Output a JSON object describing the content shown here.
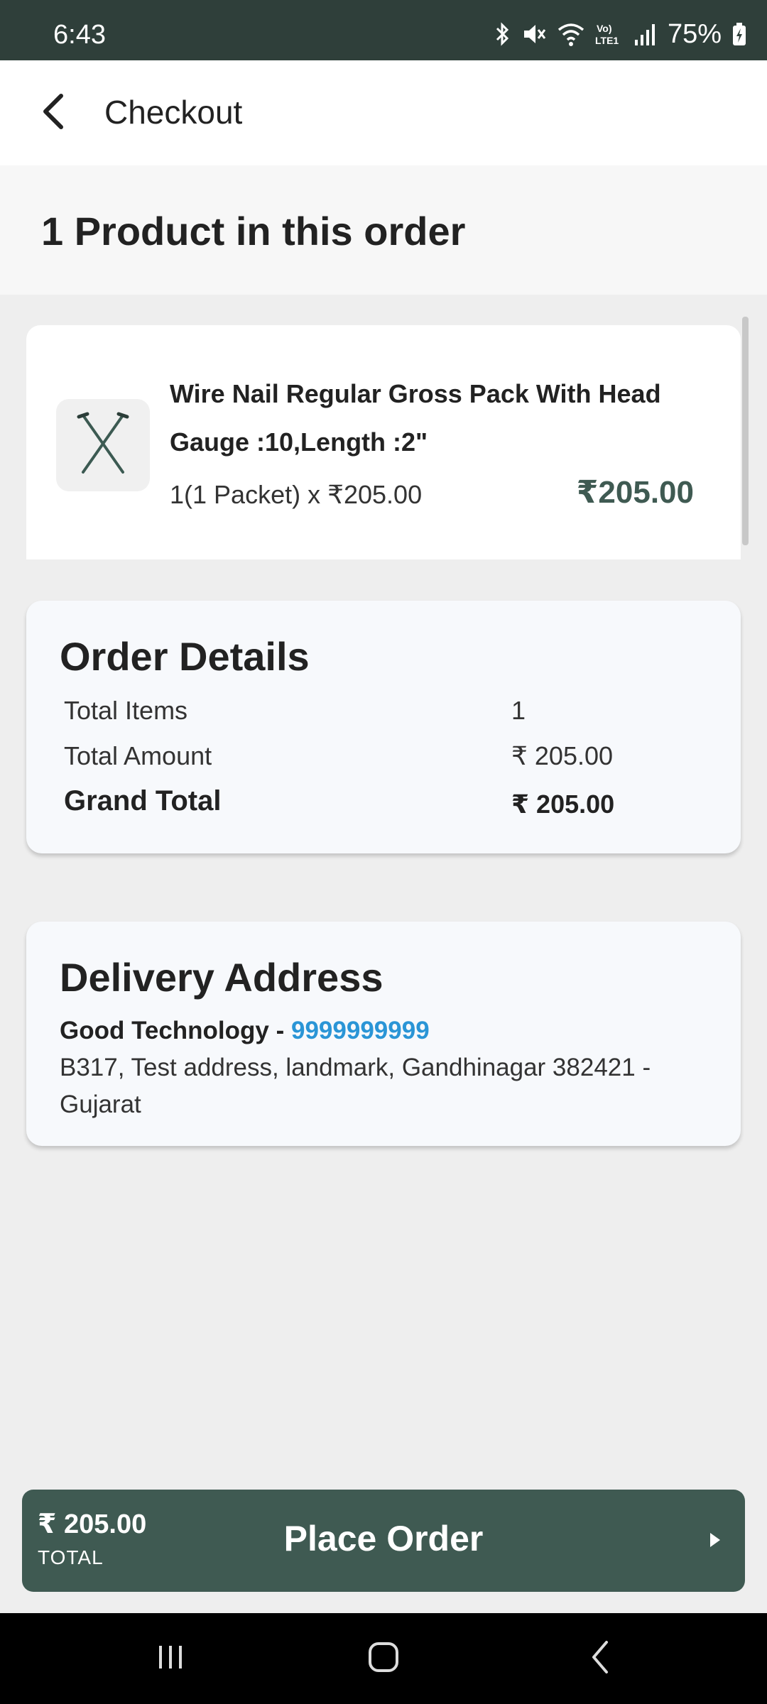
{
  "status_bar": {
    "time": "6:43",
    "battery_percent": "75%",
    "network_label": "Vo) LTE1",
    "icons": [
      "bluetooth-icon",
      "mute-icon",
      "wifi-icon",
      "lte-icon",
      "signal-icon",
      "battery-charging-icon"
    ]
  },
  "app_bar": {
    "title": "Checkout",
    "back_icon": "chevron-left-icon"
  },
  "order_heading": "1 Product in this order",
  "product": {
    "name": "Wire Nail Regular Gross Pack With Head",
    "variant": "Gauge :10,Length :2\"",
    "quantity_line": "1(1 Packet) x ₹205.00",
    "price": "₹205.00",
    "image_icon": "wire-nail-icon"
  },
  "order_details": {
    "title": "Order Details",
    "rows": [
      {
        "label": "Total Items",
        "value": "1"
      },
      {
        "label": "Total Amount",
        "value": "₹ 205.00"
      },
      {
        "label": "Grand Total",
        "value": "₹ 205.00"
      }
    ]
  },
  "delivery_address": {
    "title": "Delivery Address",
    "name": "Good Technology - ",
    "phone": "9999999999",
    "address": "B317, Test address, landmark, Gandhinagar 382421 - Gujarat"
  },
  "bottom_bar": {
    "total_amount": "₹ 205.00",
    "total_label": "TOTAL",
    "button_label": "Place Order",
    "arrow_icon": "play-arrow-icon"
  },
  "colors": {
    "status_bar": "#2f3f3a",
    "accent": "#3f5a52",
    "link": "#2a95d6"
  }
}
